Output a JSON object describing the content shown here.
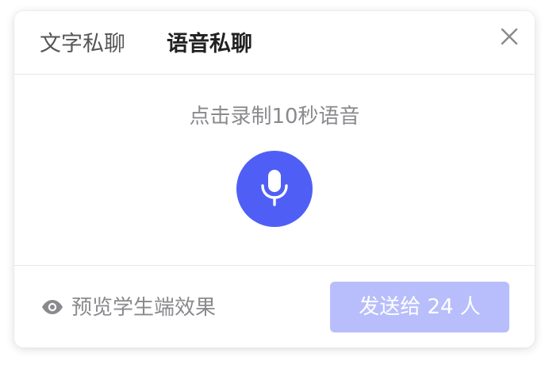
{
  "tabs": [
    {
      "label": "文字私聊",
      "active": false
    },
    {
      "label": "语音私聊",
      "active": true
    }
  ],
  "close_icon": "close-icon",
  "record": {
    "hint": "点击录制10秒语音",
    "mic_icon": "microphone-icon",
    "button_color": "#4f5ff5"
  },
  "footer": {
    "preview_label": "预览学生端效果",
    "preview_icon": "eye-icon",
    "send_label": "发送给 24 人",
    "send_color": "#b8befb"
  }
}
